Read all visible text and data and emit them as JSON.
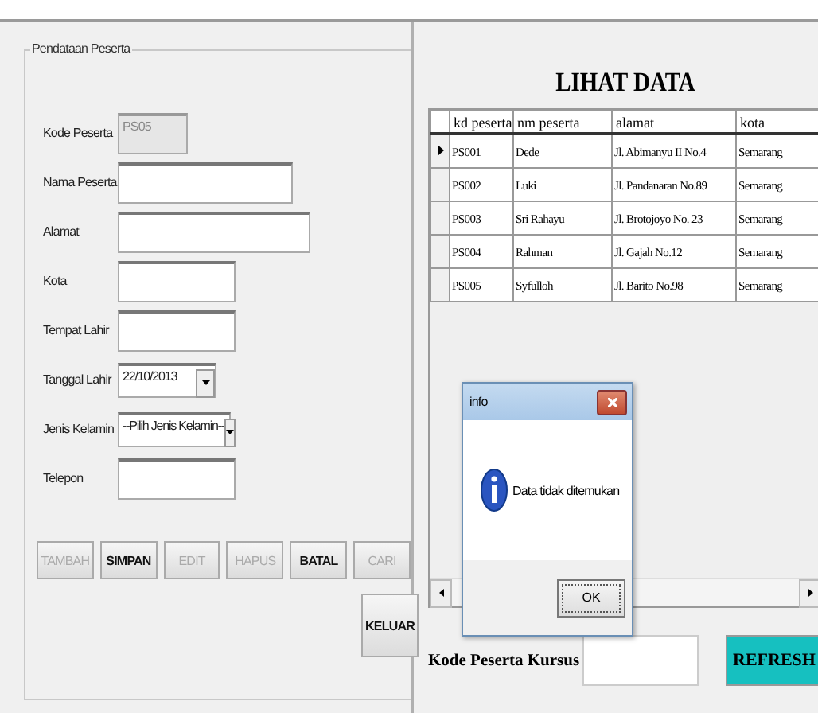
{
  "form": {
    "legend": "Pendataan Peserta",
    "fields": [
      {
        "kind": "text",
        "label": "Kode Peserta",
        "value": "PS05",
        "disabled": true
      },
      {
        "kind": "text",
        "label": "Nama Peserta",
        "disabled": false
      },
      {
        "kind": "text",
        "label": "Alamat",
        "disabled": false
      },
      {
        "kind": "text",
        "label": "Kota",
        "disabled": false
      },
      {
        "kind": "text",
        "label": "Tempat Lahir",
        "disabled": false
      },
      {
        "kind": "date",
        "label": "Tanggal Lahir",
        "value": "22/10/2013",
        "disabled": false
      },
      {
        "kind": "combo",
        "label": "Jenis Kelamin",
        "value": "--Pilih Jenis Kelamin--",
        "disabled": false
      },
      {
        "kind": "text",
        "label": "Telepon",
        "disabled": false
      }
    ],
    "buttons": [
      {
        "label": "TAMBAH",
        "disabled": true
      },
      {
        "label": "SIMPAN",
        "disabled": false
      },
      {
        "label": "EDIT",
        "disabled": true
      },
      {
        "label": "HAPUS",
        "disabled": true
      },
      {
        "label": "BATAL",
        "disabled": false
      },
      {
        "label": "CARI",
        "disabled": true
      }
    ],
    "exit_button": "KELUAR"
  },
  "data_view": {
    "title": "LIHAT DATA",
    "table": {
      "columns": [
        "kd peserta",
        "nm peserta",
        "alamat",
        "kota"
      ],
      "rows": [
        {
          "selected": true,
          "cells": [
            "PS001",
            "Dede",
            "Jl. Abimanyu II No.4",
            "Semarang"
          ]
        },
        {
          "selected": false,
          "cells": [
            "PS002",
            "Luki",
            "Jl. Pandanaran No.89",
            "Semarang"
          ]
        },
        {
          "selected": false,
          "cells": [
            "PS003",
            "Sri Rahayu",
            "Jl. Brotojoyo No. 23",
            "Semarang"
          ]
        },
        {
          "selected": false,
          "cells": [
            "PS004",
            "Rahman",
            "Jl. Gajah No.12",
            "Semarang"
          ]
        },
        {
          "selected": false,
          "cells": [
            "PS005",
            "Syfulloh",
            "Jl. Barito No.98",
            "Semarang"
          ]
        }
      ]
    },
    "search_label": "Kode Peserta Kursus",
    "refresh_button": "REFRESH"
  },
  "dialog": {
    "title": "info",
    "message": "Data tidak ditemukan",
    "ok_button": "OK"
  }
}
